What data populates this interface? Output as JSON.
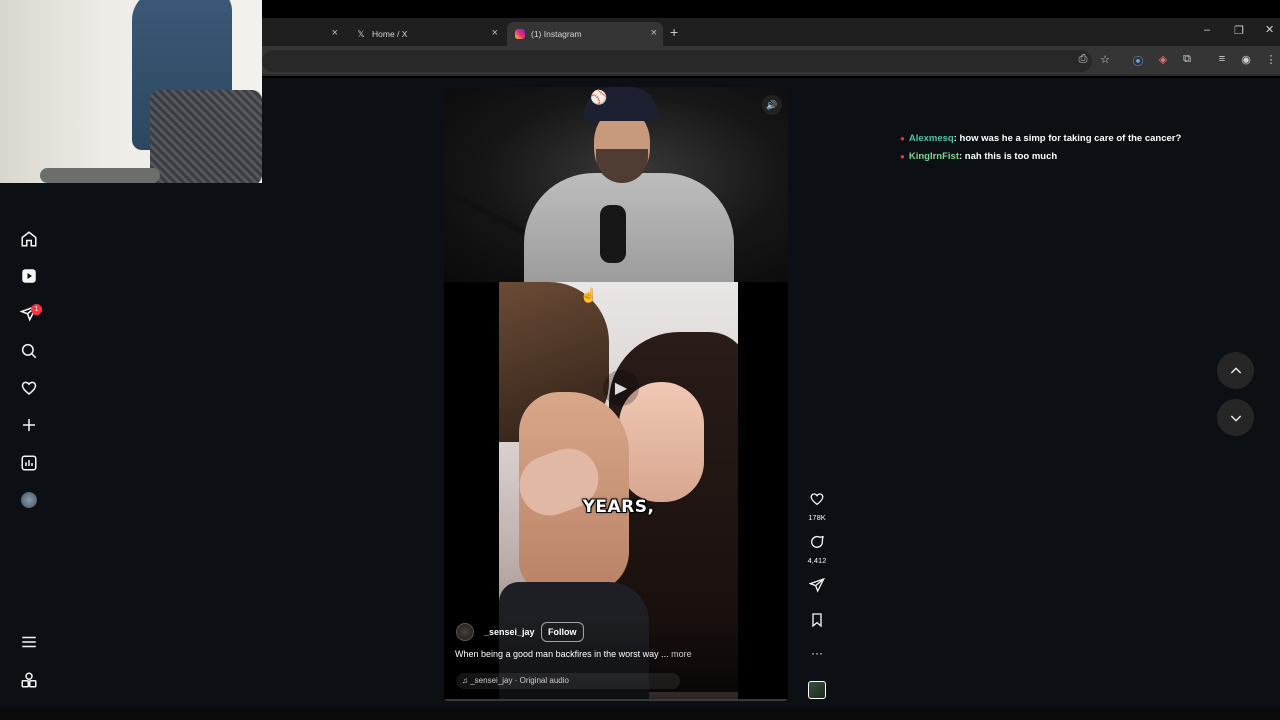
{
  "browser": {
    "tabs": [
      {
        "label": "",
        "active": false
      },
      {
        "label": "Home / X",
        "active": false
      },
      {
        "label": "(1) Instagram",
        "active": true
      }
    ],
    "close_glyph": "×",
    "new_tab_glyph": "+"
  },
  "instagram": {
    "nav": {
      "notifications_badge": "1"
    },
    "reel": {
      "overlay_caption": "YEARS,",
      "author": "_sensei_jay",
      "follow_label": "Follow",
      "description": "When being a good man backfires in the worst way ...",
      "more_label": "more",
      "audio": "_sensei_jay · Original audio",
      "likes": "178K",
      "comments": "4,412"
    }
  },
  "chat": [
    {
      "user": "Alexmesq",
      "message": ": how was he a simp for taking care of the cancer?"
    },
    {
      "user": "KingIrnFist",
      "message": ": nah this is too much"
    }
  ],
  "colors": {
    "background": "#0c1014",
    "badge": "#ff3040",
    "chat_user_1": "#4fc3a1",
    "chat_user_2": "#7bd88f"
  }
}
